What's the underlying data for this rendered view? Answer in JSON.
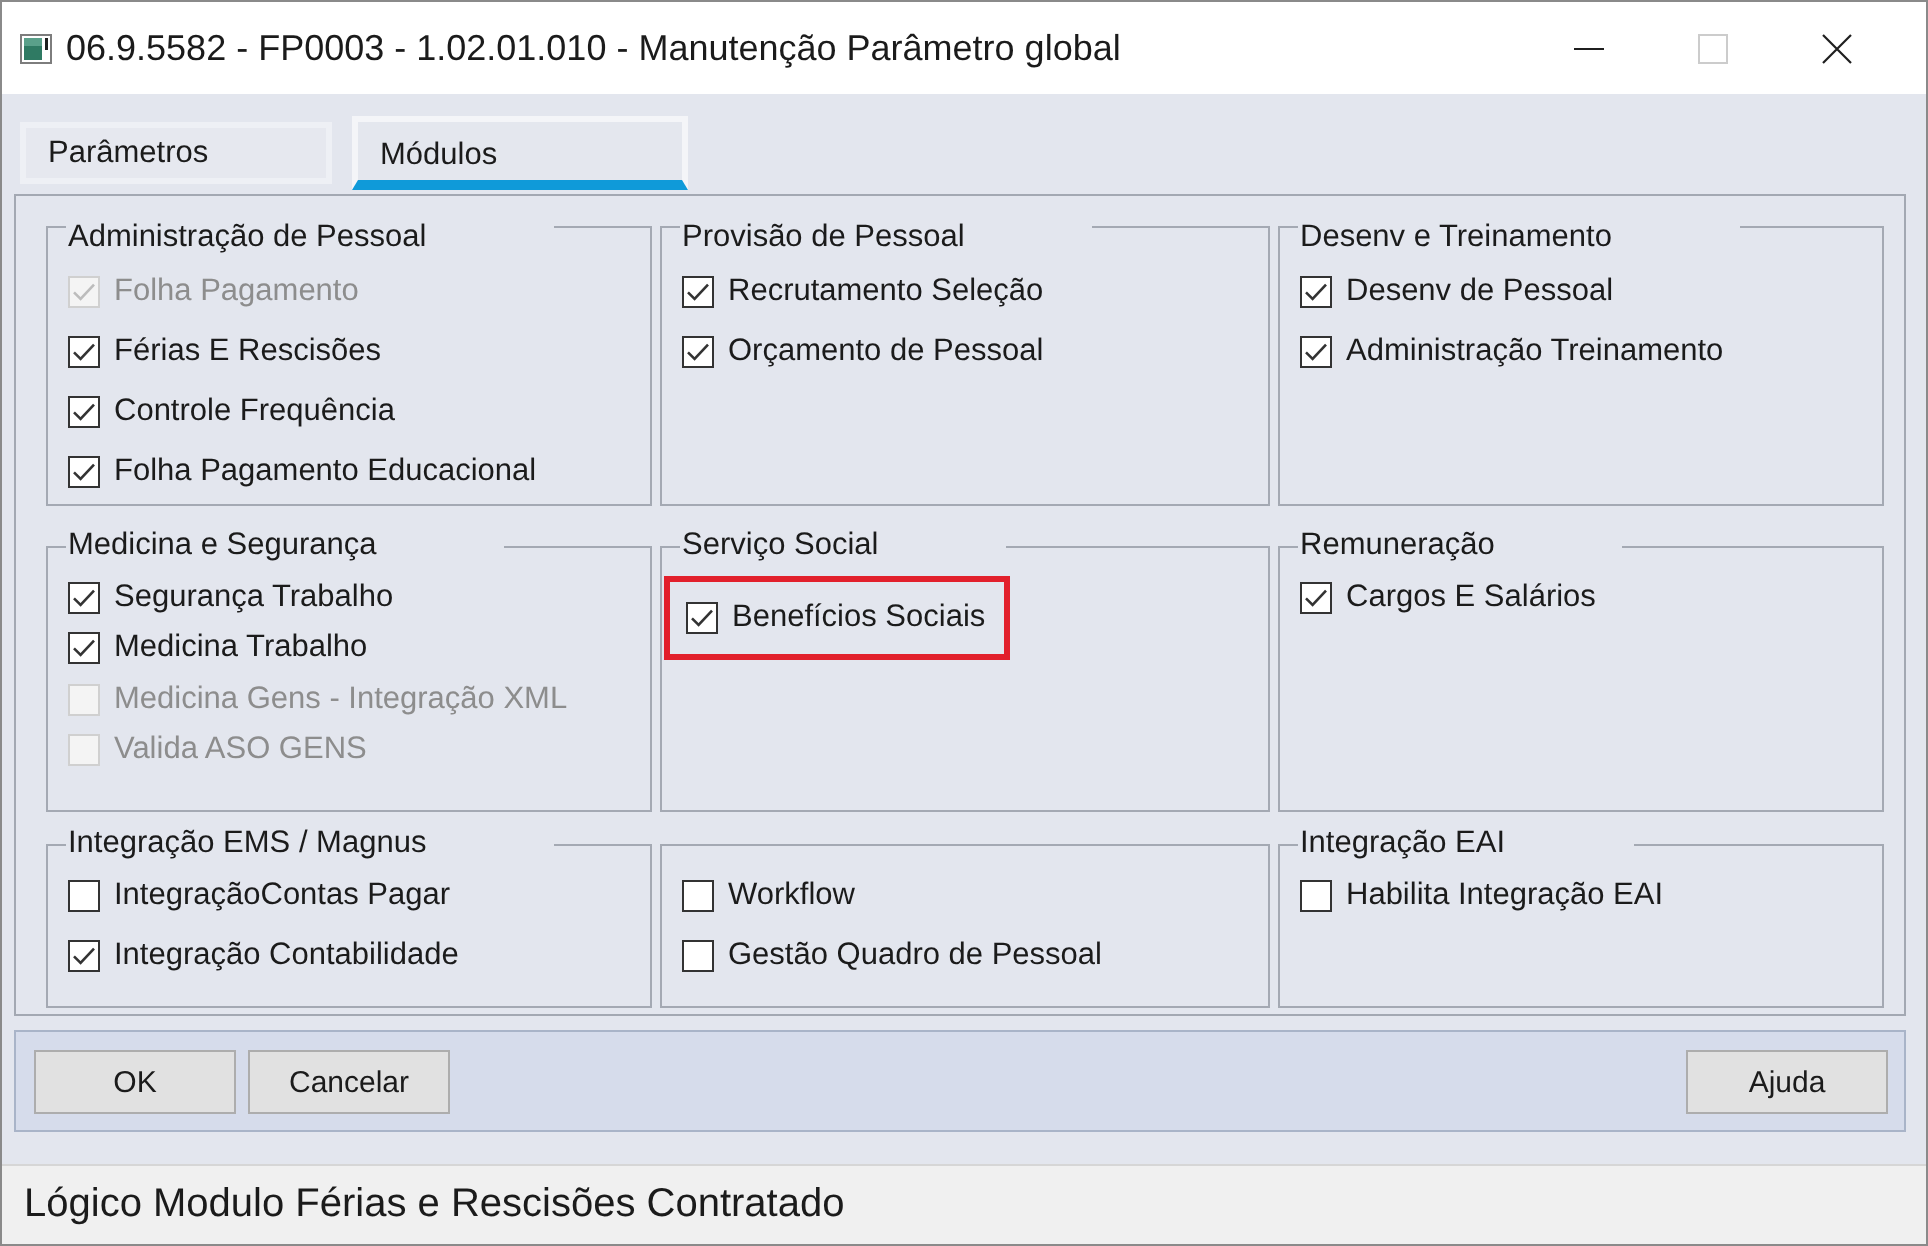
{
  "window": {
    "title": "06.9.5582 - FP0003 - 1.02.01.010 - Manutenção Parâmetro global",
    "controls": [
      {
        "kind": "minimize",
        "disabled": false
      },
      {
        "kind": "maximize",
        "disabled": true
      },
      {
        "kind": "close",
        "disabled": false
      }
    ]
  },
  "tabs": [
    {
      "label": "Parâmetros",
      "selected": false
    },
    {
      "label": "Módulos",
      "selected": true
    }
  ],
  "groups": [
    {
      "title": "Administração de Pessoal",
      "items": [
        {
          "label": "Folha Pagamento",
          "checked": true,
          "disabled": true,
          "highlighted": false
        },
        {
          "label": "Férias E Rescisões",
          "checked": true,
          "disabled": false,
          "highlighted": false
        },
        {
          "label": "Controle Frequência",
          "checked": true,
          "disabled": false,
          "highlighted": false
        },
        {
          "label": "Folha Pagamento Educacional",
          "checked": true,
          "disabled": false,
          "highlighted": false
        }
      ]
    },
    {
      "title": "Provisão de Pessoal",
      "items": [
        {
          "label": "Recrutamento Seleção",
          "checked": true,
          "disabled": false,
          "highlighted": false
        },
        {
          "label": "Orçamento de Pessoal",
          "checked": true,
          "disabled": false,
          "highlighted": false
        }
      ]
    },
    {
      "title": "Desenv e Treinamento",
      "items": [
        {
          "label": "Desenv de Pessoal",
          "checked": true,
          "disabled": false,
          "highlighted": false
        },
        {
          "label": "Administração Treinamento",
          "checked": true,
          "disabled": false,
          "highlighted": false
        }
      ]
    },
    {
      "title": "Medicina e Segurança",
      "items": [
        {
          "label": "Segurança Trabalho",
          "checked": true,
          "disabled": false,
          "highlighted": false
        },
        {
          "label": "Medicina Trabalho",
          "checked": true,
          "disabled": false,
          "highlighted": false
        },
        {
          "label": "Medicina Gens - Integração XML",
          "checked": false,
          "disabled": true,
          "highlighted": false
        },
        {
          "label": "Valida ASO GENS",
          "checked": false,
          "disabled": true,
          "highlighted": false
        }
      ]
    },
    {
      "title": "Serviço Social",
      "items": [
        {
          "label": "Benefícios Sociais",
          "checked": true,
          "disabled": false,
          "highlighted": true
        }
      ]
    },
    {
      "title": "Remuneração",
      "items": [
        {
          "label": "Cargos E Salários",
          "checked": true,
          "disabled": false,
          "highlighted": false
        }
      ]
    },
    {
      "title": "Integração EMS / Magnus",
      "items": [
        {
          "label": "IntegraçãoContas Pagar",
          "checked": false,
          "disabled": false,
          "highlighted": false
        },
        {
          "label": "Integração Contabilidade",
          "checked": true,
          "disabled": false,
          "highlighted": false
        }
      ]
    },
    {
      "items": [
        {
          "label": "Workflow",
          "checked": false,
          "disabled": false,
          "highlighted": false
        },
        {
          "label": "Gestão Quadro de Pessoal",
          "checked": false,
          "disabled": false,
          "highlighted": false
        }
      ]
    },
    {
      "title": "Integração EAI",
      "items": [
        {
          "label": "Habilita Integração EAI",
          "checked": false,
          "disabled": false,
          "highlighted": false
        }
      ]
    }
  ],
  "action_buttons": [
    "OK",
    "Cancelar"
  ],
  "help_button": "Ajuda",
  "status_bar": "Lógico Modulo Férias e Rescisões Contratado"
}
